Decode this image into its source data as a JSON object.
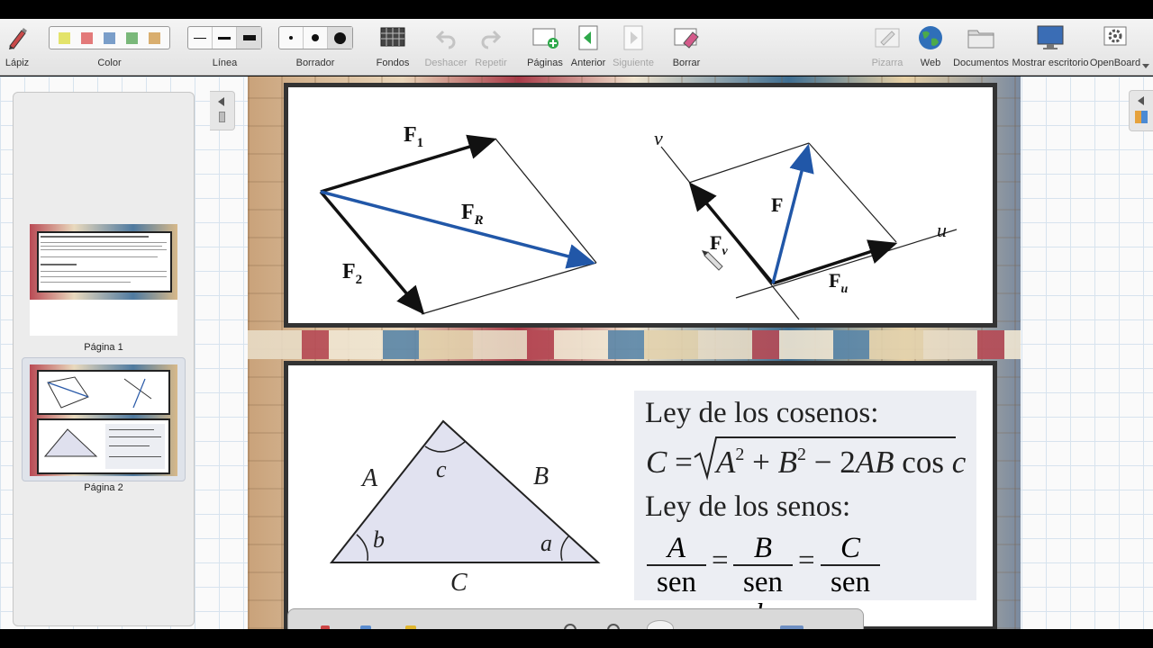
{
  "toolbar": {
    "pencil": "Lápiz",
    "color": "Color",
    "line": "Línea",
    "eraser": "Borrador",
    "backgrounds": "Fondos",
    "undo": "Deshacer",
    "redo": "Repetir",
    "pages": "Páginas",
    "previous": "Anterior",
    "next": "Siguiente",
    "clear": "Borrar",
    "board": "Pizarra",
    "web": "Web",
    "documents": "Documentos",
    "show_desktop": "Mostrar escritorio",
    "openboard": "OpenBoard",
    "swatches": [
      "#e3e36a",
      "#e37a7a",
      "#7a9ec9",
      "#7ab87a",
      "#d9ae6e"
    ]
  },
  "pages": [
    {
      "label": "Página 1"
    },
    {
      "label": "Página 2"
    }
  ],
  "vectors": {
    "f1": "F",
    "f1_sub": "1",
    "f2": "F",
    "f2_sub": "2",
    "fr": "F",
    "fr_sub": "R",
    "f": "F",
    "fv": "F",
    "fv_sub": "v",
    "fu": "F",
    "fu_sub": "u",
    "u": "u",
    "v": "v"
  },
  "triangle": {
    "side_a": "A",
    "side_b": "B",
    "side_c": "C",
    "angle_a": "a",
    "angle_b": "b",
    "angle_c": "c"
  },
  "laws": {
    "cos_title": "Ley de los cosenos:",
    "sin_title": "Ley de los senos:",
    "sen": "sen"
  }
}
